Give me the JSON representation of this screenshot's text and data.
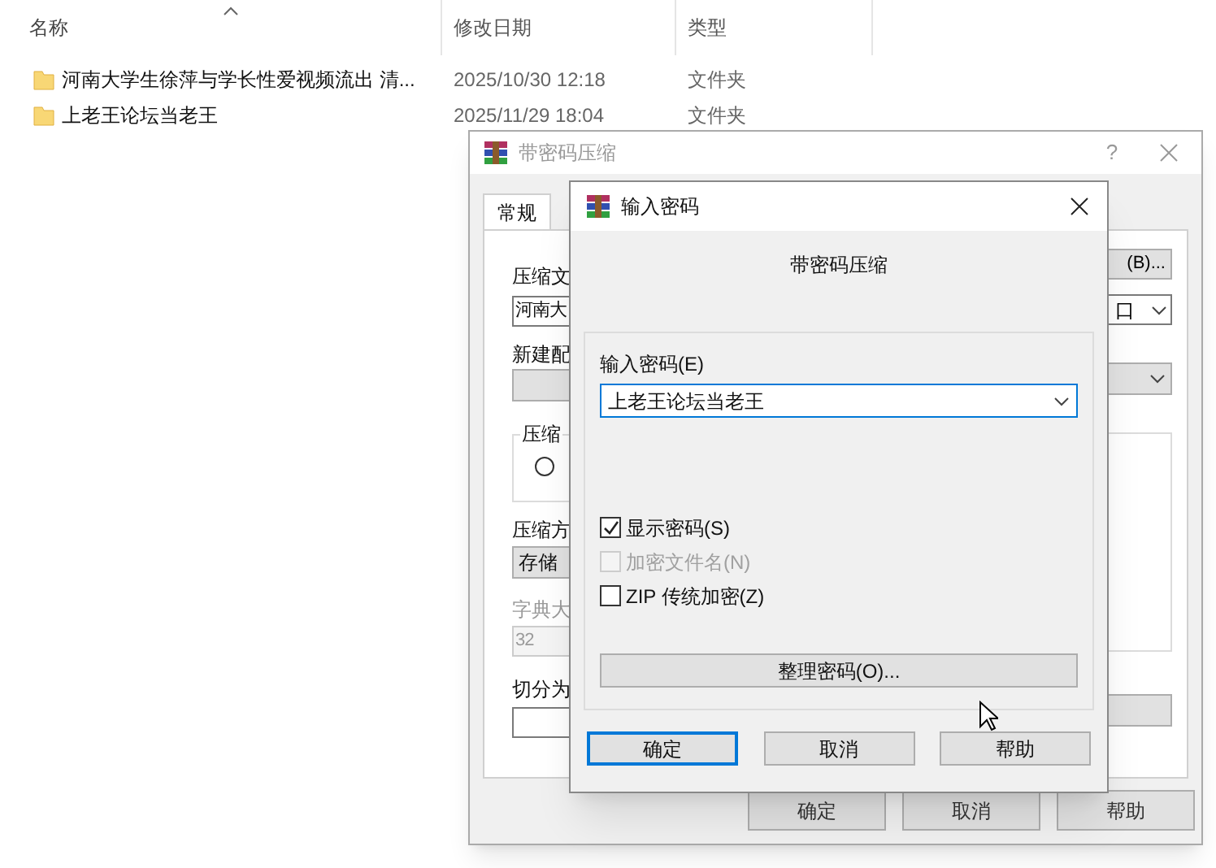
{
  "explorer": {
    "columns": [
      {
        "label": "名称",
        "sorted": true
      },
      {
        "label": "修改日期",
        "sorted": false
      },
      {
        "label": "类型",
        "sorted": false
      }
    ],
    "rows": [
      {
        "name": "河南大学生徐萍与学长性爱视频流出 清...",
        "modified": "2025/10/30 12:18",
        "type": "文件夹"
      },
      {
        "name": "上老王论坛当老王",
        "modified": "2025/11/29 18:04",
        "type": "文件夹"
      }
    ]
  },
  "archive_dialog": {
    "title": "带密码压缩",
    "help": "?",
    "tabs": [
      {
        "label": "常规",
        "selected": true
      }
    ],
    "left_items": [
      {
        "kind": "label",
        "text": "压缩文",
        "disabled": false
      },
      {
        "kind": "field",
        "text": "河南大",
        "disabled": false
      },
      {
        "kind": "label",
        "text": "新建配",
        "disabled": false
      },
      {
        "kind": "combo",
        "disabled": false
      },
      {
        "kind": "group",
        "text": "压缩",
        "disabled": false
      },
      {
        "kind": "label",
        "text": "压缩方",
        "disabled": false
      },
      {
        "kind": "combo",
        "text": "存储",
        "disabled": false
      },
      {
        "kind": "label",
        "text": "字典大",
        "disabled": true
      },
      {
        "kind": "field",
        "text": "32",
        "disabled": true
      },
      {
        "kind": "label",
        "text": "切分为",
        "disabled": false
      },
      {
        "kind": "field",
        "disabled": false
      }
    ],
    "browse_button": "(B)...",
    "format_combo": "口",
    "buttons": [
      "确定",
      "取消",
      "帮助"
    ]
  },
  "password_dialog": {
    "title": "输入密码",
    "heading": "带密码压缩",
    "field_label": "输入密码(E)",
    "value": "上老王论坛当老王",
    "options": [
      {
        "label": "显示密码(S)",
        "checked": true,
        "disabled": false
      },
      {
        "label": "加密文件名(N)",
        "checked": false,
        "disabled": true
      },
      {
        "label": "ZIP 传统加密(Z)",
        "checked": false,
        "disabled": false
      }
    ],
    "manage_button": "整理密码(O)...",
    "buttons": [
      {
        "label": "确定",
        "default": true
      },
      {
        "label": "取消",
        "default": false
      },
      {
        "label": "帮助",
        "default": false
      }
    ]
  }
}
